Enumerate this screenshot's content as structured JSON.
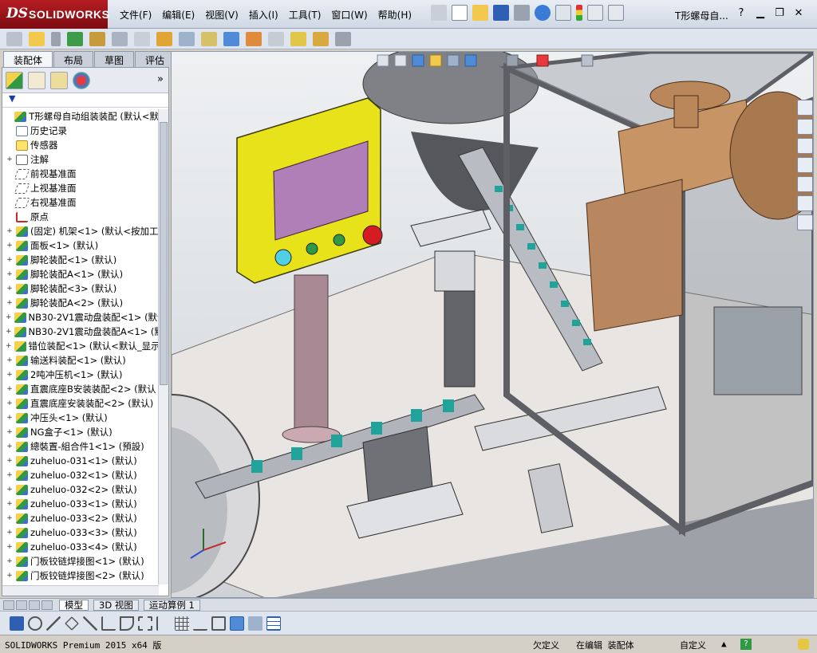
{
  "app": {
    "brand_ds": "DS",
    "brand_name": "SOLIDWORKS",
    "document_title": "T形螺母自...",
    "menus": [
      "文件(F)",
      "编辑(E)",
      "视图(V)",
      "插入(I)",
      "工具(T)",
      "窗口(W)",
      "帮助(H)"
    ],
    "help_icon": "?"
  },
  "left_panel": {
    "tabs": [
      "装配体",
      "布局",
      "草图",
      "评估"
    ],
    "active_tab": "装配体",
    "tree": [
      {
        "label": "T形螺母自动组装装配  (默认<默",
        "icon": "assembly",
        "expand": ""
      },
      {
        "label": "历史记录",
        "icon": "history",
        "expand": ""
      },
      {
        "label": "传感器",
        "icon": "sensor",
        "expand": ""
      },
      {
        "label": "注解",
        "icon": "annotation",
        "expand": "+"
      },
      {
        "label": "前视基准面",
        "icon": "plane",
        "expand": ""
      },
      {
        "label": "上视基准面",
        "icon": "plane",
        "expand": ""
      },
      {
        "label": "右视基准面",
        "icon": "plane",
        "expand": ""
      },
      {
        "label": "原点",
        "icon": "origin",
        "expand": ""
      },
      {
        "label": "(固定) 机架<1> (默认<按加工",
        "icon": "assembly",
        "expand": "+"
      },
      {
        "label": "面板<1> (默认)",
        "icon": "assembly",
        "expand": "+"
      },
      {
        "label": "脚轮装配<1> (默认)",
        "icon": "assembly",
        "expand": "+"
      },
      {
        "label": "脚轮装配A<1> (默认)",
        "icon": "assembly",
        "expand": "+"
      },
      {
        "label": "脚轮装配<3> (默认)",
        "icon": "assembly",
        "expand": "+"
      },
      {
        "label": "脚轮装配A<2> (默认)",
        "icon": "assembly",
        "expand": "+"
      },
      {
        "label": "NB30-2V1震动盘装配<1> (默认",
        "icon": "assembly",
        "expand": "+"
      },
      {
        "label": "NB30-2V1震动盘装配A<1> (默",
        "icon": "assembly",
        "expand": "+"
      },
      {
        "label": "错位装配<1> (默认<默认_显示",
        "icon": "part",
        "expand": "+"
      },
      {
        "label": "输送料装配<1> (默认)",
        "icon": "assembly",
        "expand": "+"
      },
      {
        "label": "2吨冲压机<1> (默认)",
        "icon": "assembly",
        "expand": "+"
      },
      {
        "label": "直震底座B安装装配<2> (默认",
        "icon": "assembly",
        "expand": "+"
      },
      {
        "label": "直震底座安装装配<2> (默认)",
        "icon": "assembly",
        "expand": "+"
      },
      {
        "label": "冲压头<1> (默认)",
        "icon": "assembly",
        "expand": "+"
      },
      {
        "label": "NG盒子<1> (默认)",
        "icon": "assembly",
        "expand": "+"
      },
      {
        "label": "總裝置-組合件1<1> (預設)",
        "icon": "assembly",
        "expand": "+"
      },
      {
        "label": "zuheluo-031<1> (默认)",
        "icon": "assembly",
        "expand": "+"
      },
      {
        "label": "zuheluo-032<1> (默认)",
        "icon": "assembly",
        "expand": "+"
      },
      {
        "label": "zuheluo-032<2> (默认)",
        "icon": "assembly",
        "expand": "+"
      },
      {
        "label": "zuheluo-033<1> (默认)",
        "icon": "assembly",
        "expand": "+"
      },
      {
        "label": "zuheluo-033<2> (默认)",
        "icon": "assembly",
        "expand": "+"
      },
      {
        "label": "zuheluo-033<3> (默认)",
        "icon": "assembly",
        "expand": "+"
      },
      {
        "label": "zuheluo-033<4> (默认)",
        "icon": "assembly",
        "expand": "+"
      },
      {
        "label": "门板铰链焊接图<1> (默认)",
        "icon": "assembly",
        "expand": "+"
      },
      {
        "label": "门板铰链焊接图<2> (默认)",
        "icon": "assembly",
        "expand": "+"
      }
    ]
  },
  "bottom_tabs": [
    "模型",
    "3D 视图",
    "运动算例 1"
  ],
  "active_bottom_tab": "模型",
  "status_bar": {
    "product": "SOLIDWORKS Premium 2015 x64 版",
    "state1": "欠定义",
    "state2": "在编辑 装配体",
    "custom": "自定义"
  },
  "colors": {
    "brand_red": "#b51e23",
    "control_box_yellow": "#e8e21a",
    "screen_purple": "#b07fb8",
    "track_teal": "#1fa39a",
    "frame_gray": "#6d6f75",
    "accent_orange": "#f08a1c"
  },
  "icons": {
    "quickbar": [
      "options-icon",
      "new-icon",
      "open-icon",
      "save-icon",
      "print-icon",
      "undo-icon",
      "select-icon",
      "rebuild-icon",
      "file-properties-icon",
      "options-dropdown-icon"
    ],
    "window": [
      "minimize-icon",
      "restore-icon",
      "close-icon"
    ]
  }
}
